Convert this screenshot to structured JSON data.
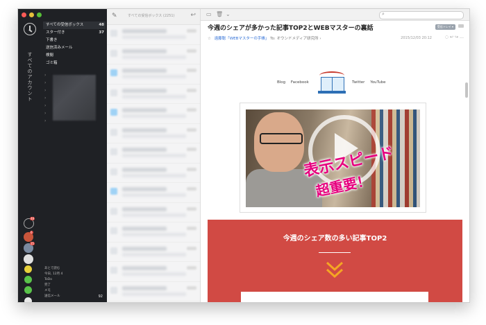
{
  "sidebar": {
    "folders": [
      {
        "label": "すべての受信ボックス",
        "count": "48"
      },
      {
        "label": "スター付き",
        "count": "37"
      },
      {
        "label": "下書き",
        "count": ""
      },
      {
        "label": "送信済みメール",
        "count": ""
      },
      {
        "label": "検閲",
        "count": ""
      },
      {
        "label": "ゴミ箱",
        "count": ""
      }
    ],
    "rail_label": "すべてのアカウント",
    "badges": [
      "48",
      "6",
      "35"
    ],
    "bottom": [
      {
        "label": "あとで読む",
        "count": ""
      },
      {
        "label": "今日, 12月 4",
        "count": ""
      },
      {
        "label": "ToDo",
        "count": ""
      },
      {
        "label": "完了",
        "count": ""
      },
      {
        "label": "メモ",
        "count": ""
      },
      {
        "label": "送信メール",
        "count": "92"
      }
    ]
  },
  "list": {
    "title": "すべての受信ボックス (2251)"
  },
  "reader": {
    "subject": "今週のシェアが多かった記事TOP2とWEBマスターの裏話",
    "sender": "遠藤聡「WEBマスターの手帳」",
    "to": "To: オウンドメディア研究所 ›",
    "date": "2015/12/03 20:12",
    "label_pill": "受信トレイ ▾",
    "search_placeholder": "",
    "nav_left": [
      "Blog",
      "Facebook"
    ],
    "nav_right": [
      "Twitter",
      "YouTube"
    ],
    "video_caption_line1": "表示スピード",
    "video_caption_line2": "超重要！",
    "banner_title": "今週のシェア数の多い記事TOP2"
  },
  "colors": {
    "sidebar_bg": "#1f2125",
    "banner": "#d14a44",
    "accent_orange": "#f5a623",
    "link_blue": "#2f6fd6"
  }
}
